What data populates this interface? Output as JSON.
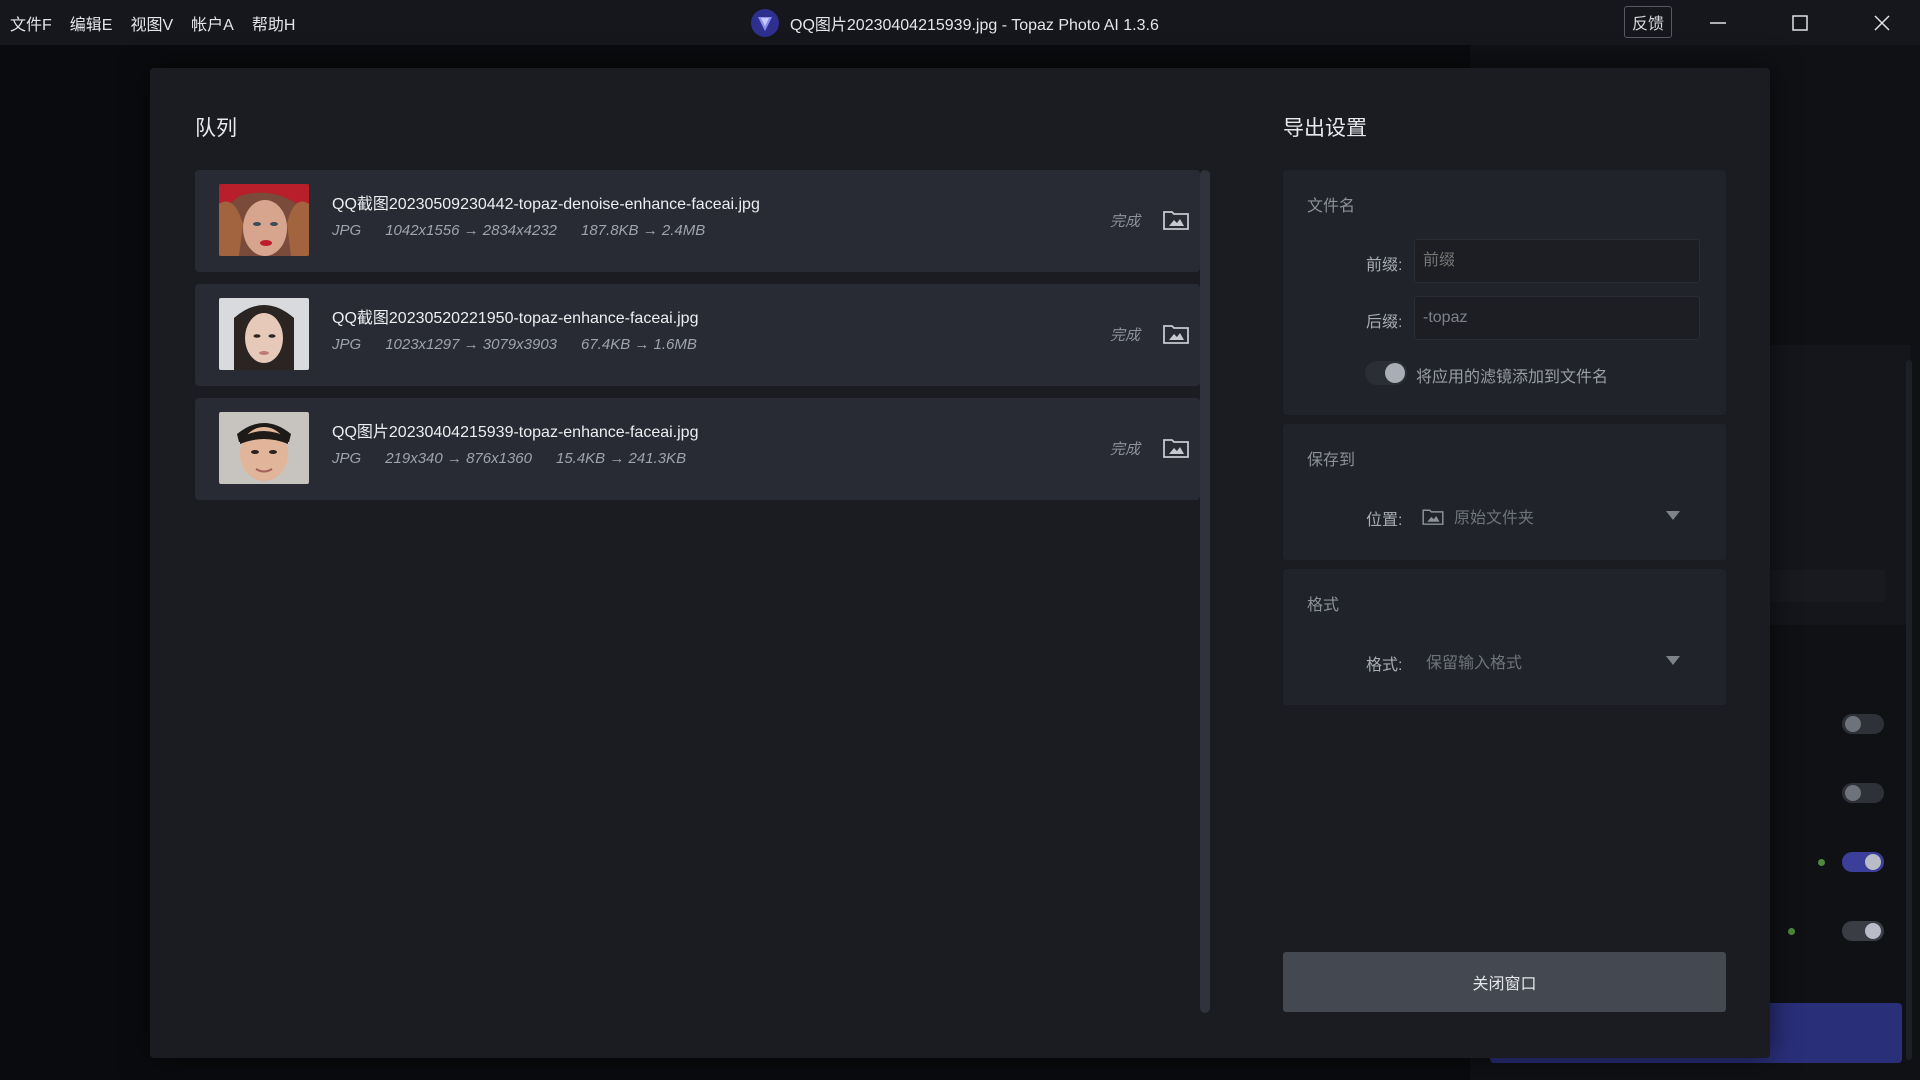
{
  "titlebar": {
    "menu": [
      "文件F",
      "编辑E",
      "视图V",
      "帐户A",
      "帮助H"
    ],
    "title": "QQ图片20230404215939.jpg - Topaz Photo AI 1.3.6",
    "feedback": "反馈"
  },
  "queue": {
    "title": "队列",
    "items": [
      {
        "filename": "QQ截图20230509230442-topaz-denoise-enhance-faceai.jpg",
        "format": "JPG",
        "resolution": "1042x1556 → 2834x4232",
        "size": "187.8KB → 2.4MB",
        "status": "完成"
      },
      {
        "filename": "QQ截图20230520221950-topaz-enhance-faceai.jpg",
        "format": "JPG",
        "resolution": "1023x1297 → 3079x3903",
        "size": "67.4KB → 1.6MB",
        "status": "完成"
      },
      {
        "filename": "QQ图片20230404215939-topaz-enhance-faceai.jpg",
        "format": "JPG",
        "resolution": "219x340 → 876x1360",
        "size": "15.4KB → 241.3KB",
        "status": "完成"
      }
    ]
  },
  "export": {
    "title": "导出设置",
    "filename_card": {
      "title": "文件名",
      "prefix_label": "前缀:",
      "prefix_placeholder": "前缀",
      "suffix_label": "后缀:",
      "suffix_value": "-topaz",
      "append_filters_label": "将应用的滤镜添加到文件名",
      "append_filters_on": true
    },
    "save_card": {
      "title": "保存到",
      "location_label": "位置:",
      "location_value": "原始文件夹"
    },
    "format_card": {
      "title": "格式",
      "format_label": "格式:",
      "format_value": "保留输入格式"
    },
    "close_button": "关闭窗口"
  },
  "colors": {
    "accent": "#3c3f9a",
    "dialog_bg": "#1a1c21",
    "card_bg": "#282b33"
  }
}
